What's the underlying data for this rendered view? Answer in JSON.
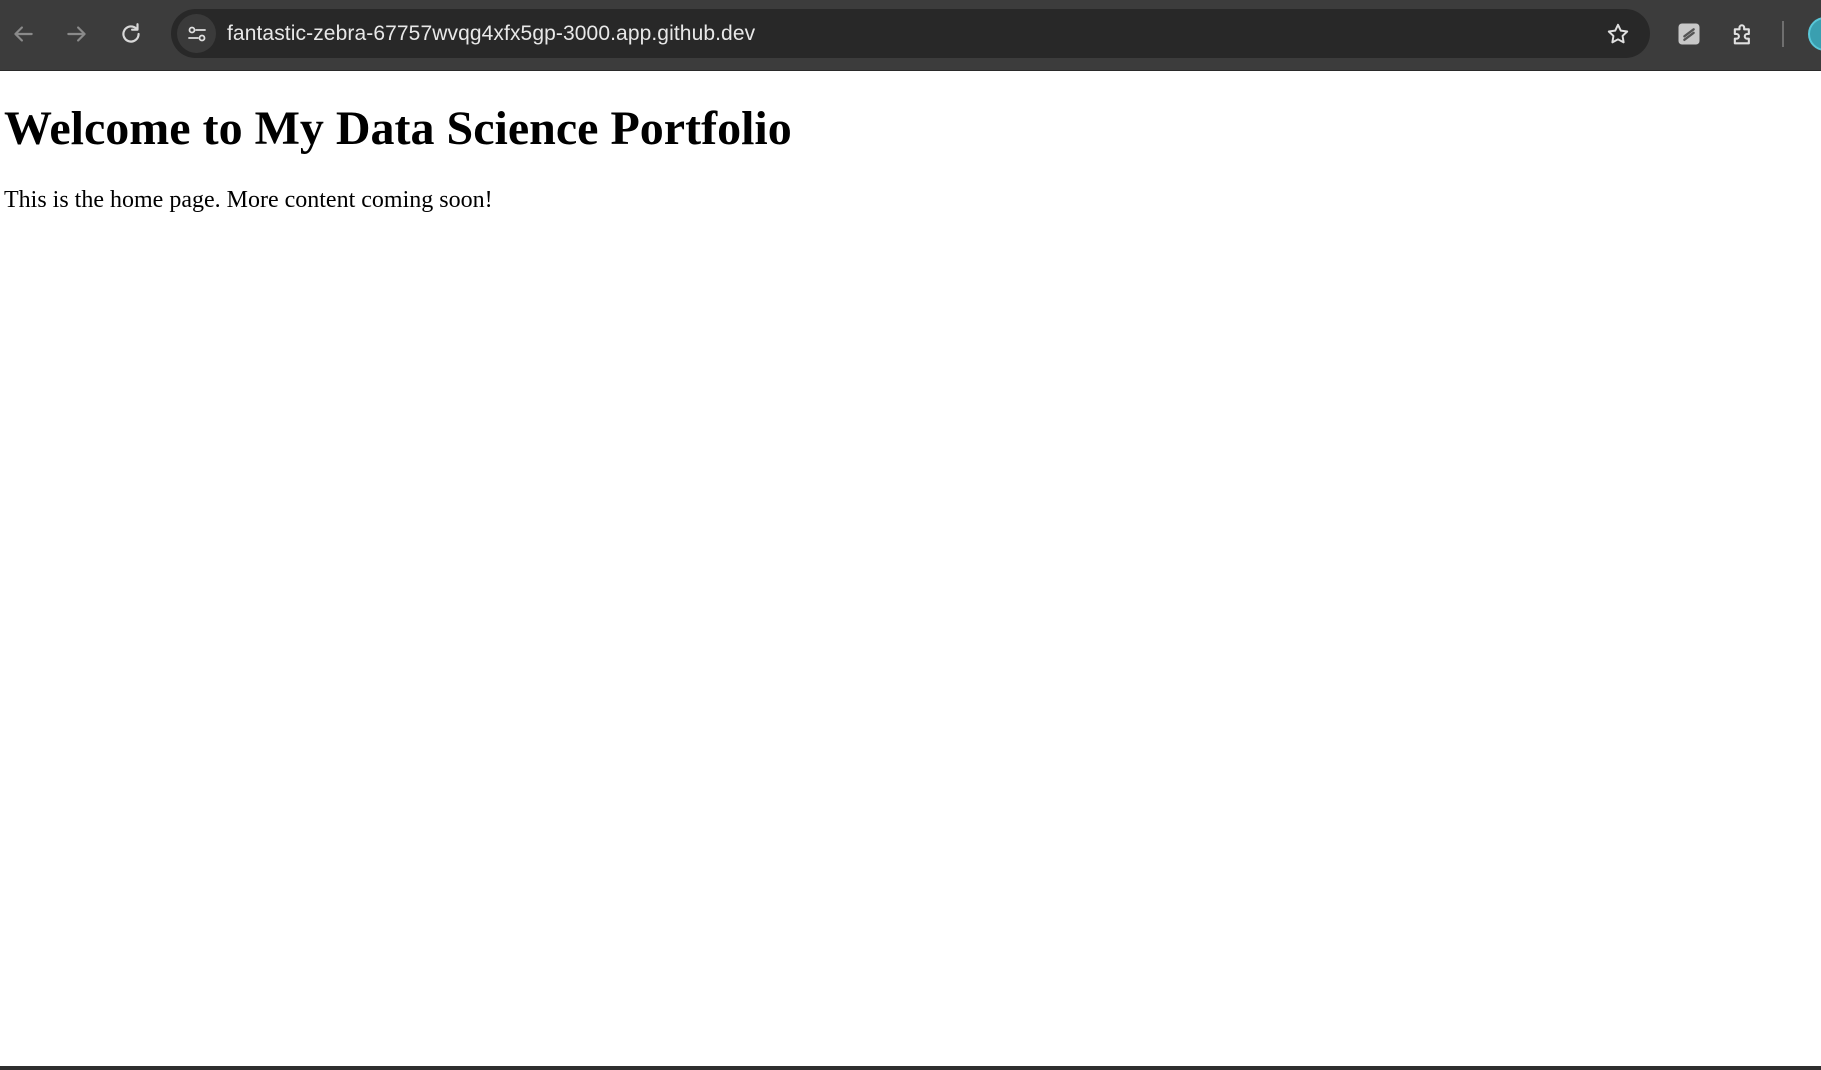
{
  "browser": {
    "url": "fantastic-zebra-67757wvqg4xfx5gp-3000.app.github.dev",
    "icons": {
      "back": "arrow-left-icon",
      "forward": "arrow-right-icon",
      "reload": "reload-icon",
      "site_info": "tune-icon",
      "bookmark": "star-icon",
      "extension_pinned": "extension-icon",
      "extensions_menu": "puzzle-icon",
      "profile": "avatar"
    },
    "colors": {
      "toolbar": "#3c3c3c",
      "omnibox": "#282828",
      "avatar": "#3a9fb0"
    }
  },
  "page": {
    "title": "Welcome to My Data Science Portfolio",
    "text": "This is the home page. More content coming soon!"
  }
}
